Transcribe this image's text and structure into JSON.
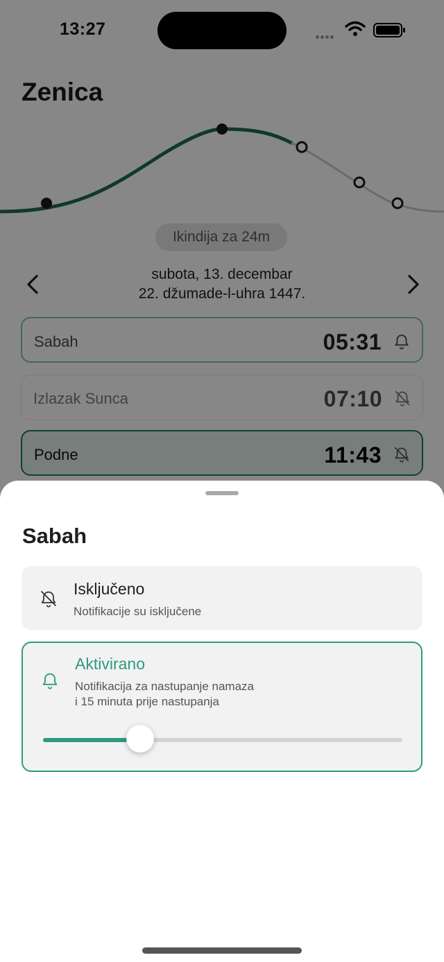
{
  "status": {
    "time": "13:27"
  },
  "header": {
    "city": "Zenica"
  },
  "next_prayer": {
    "label": "Ikindija za 24m"
  },
  "date": {
    "gregorian": "subota, 13. decembar",
    "hijri": "22. džumade-l-uhra 1447."
  },
  "prayers": [
    {
      "name": "Sabah",
      "time": "05:31",
      "notification": "on",
      "icon": "bell-icon"
    },
    {
      "name": "Izlazak Sunca",
      "time": "07:10",
      "notification": "off",
      "icon": "bell-off-icon"
    },
    {
      "name": "Podne",
      "time": "11:43",
      "notification": "off",
      "icon": "bell-off-icon"
    }
  ],
  "sheet": {
    "title": "Sabah",
    "options": [
      {
        "title": "Isključeno",
        "description": "Notifikacije su isključene",
        "icon": "bell-off-icon",
        "selected": false
      },
      {
        "title": "Aktivirano",
        "description_line1": "Notifikacija za nastupanje namaza",
        "description_line2": "i 15 minuta prije nastupanja",
        "icon": "bell-icon",
        "selected": true,
        "slider_fraction": 0.27
      }
    ]
  },
  "colors": {
    "accent": "#2f9a7e",
    "curve_active": "#1e6b5a",
    "curve_inactive": "#c9c9c9"
  }
}
